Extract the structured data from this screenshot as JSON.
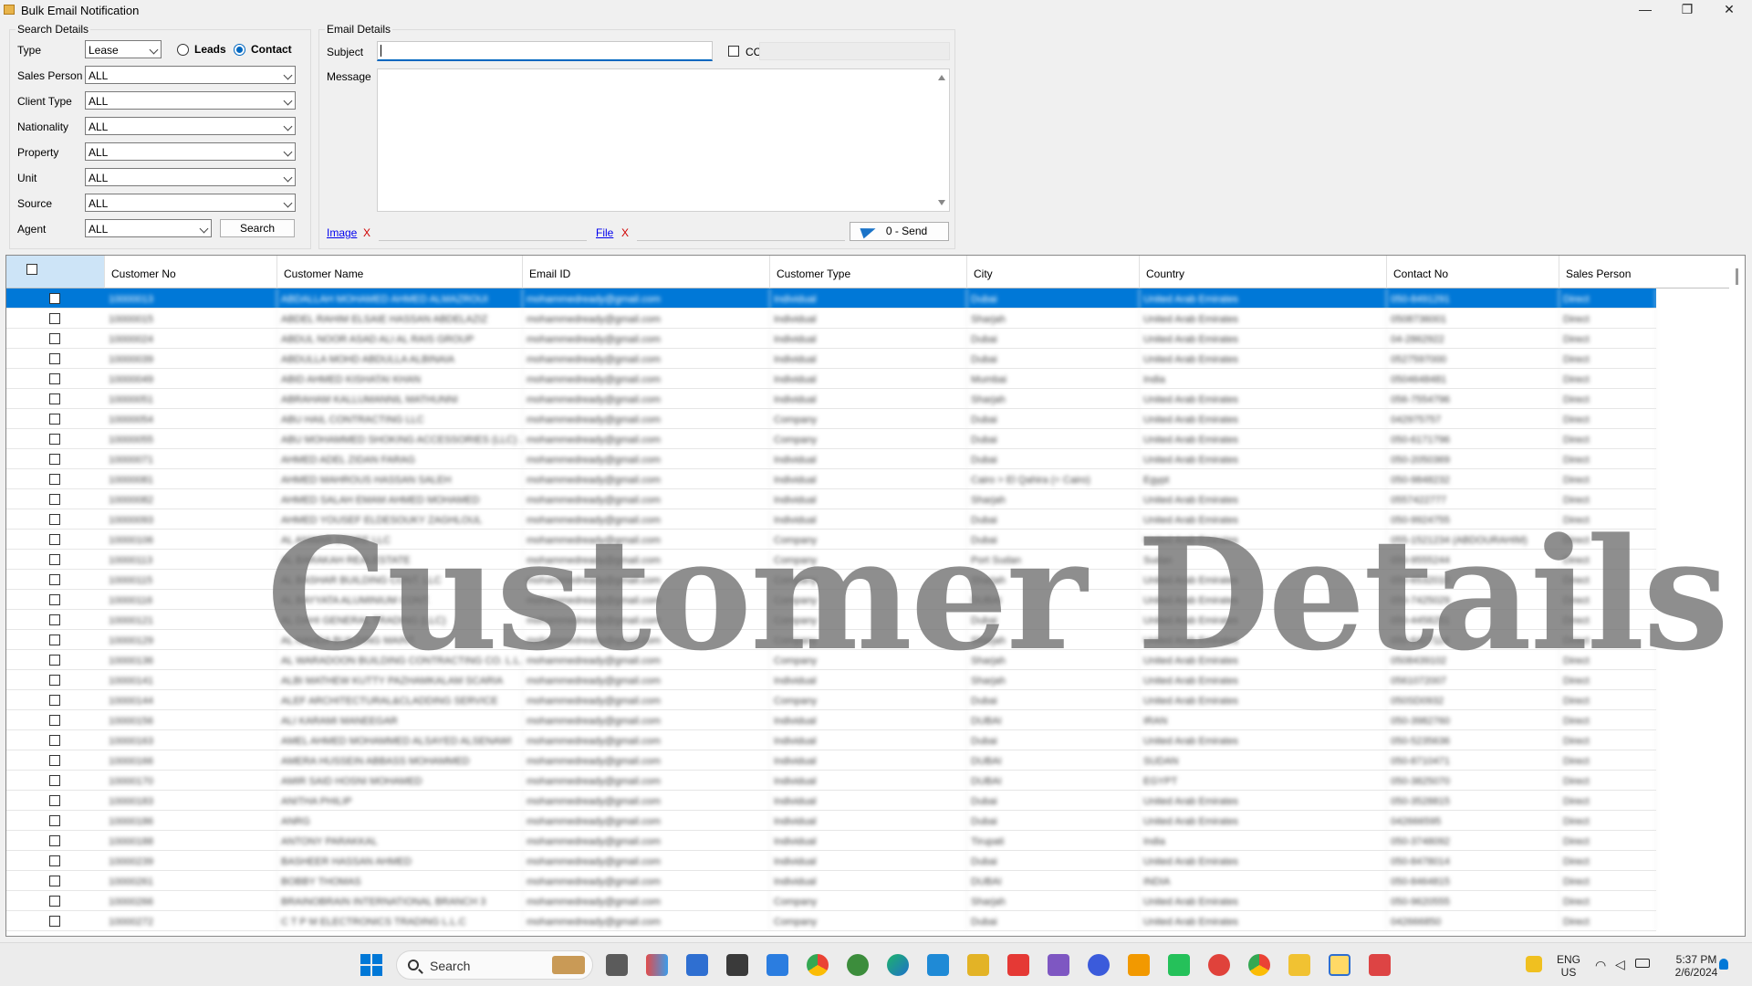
{
  "window": {
    "title": "Bulk Email Notification",
    "controls": {
      "minimize": "—",
      "restore": "❐",
      "close": "✕"
    }
  },
  "search_details": {
    "legend": "Search Details",
    "type_label": "Type",
    "type_value": "Lease",
    "radio_leads": "Leads",
    "radio_contact": "Contact",
    "selected_radio": "Contact",
    "fields": [
      {
        "label": "Sales Person",
        "value": "ALL"
      },
      {
        "label": "Client Type",
        "value": "ALL"
      },
      {
        "label": "Nationality",
        "value": "ALL"
      },
      {
        "label": "Property",
        "value": "ALL"
      },
      {
        "label": "Unit",
        "value": "ALL"
      },
      {
        "label": "Source",
        "value": "ALL"
      }
    ],
    "agent_label": "Agent",
    "agent_value": "ALL",
    "search_button": "Search"
  },
  "email_details": {
    "legend": "Email Details",
    "subject_label": "Subject",
    "subject_value": "",
    "cc_label": "CC",
    "message_label": "Message",
    "image_link": "Image",
    "file_link": "File",
    "remove_glyph": "X",
    "send_button": "0 - Send"
  },
  "grid": {
    "columns": [
      "Customer No",
      "Customer Name",
      "Email ID",
      "Customer Type",
      "City",
      "Country",
      "Contact No",
      "Sales Person"
    ],
    "selected_row": 0,
    "rows": [
      [
        "10000013",
        "ABDALLAH MOHAMED AHMED ALMAZROUI",
        "mohammedready@gmail.com",
        "Individual",
        "Dubai",
        "United Arab Emirates",
        "050-8491291",
        "Direct"
      ],
      [
        "10000015",
        "ABDEL RAHIM ELSAIE HASSAN ABDELAZIZ",
        "mohammedready@gmail.com",
        "Individual",
        "Sharjah",
        "United Arab Emirates",
        "0508736001",
        "Direct"
      ],
      [
        "10000024",
        "ABDUL NOOR ASAD ALI AL RAIS GROUP",
        "mohammedready@gmail.com",
        "Individual",
        "Dubai",
        "United Arab Emirates",
        "04-2862922",
        "Direct"
      ],
      [
        "10000039",
        "ABDULLA MOHD ABDULLA ALBINAIA",
        "mohammedready@gmail.com",
        "Individual",
        "Dubai",
        "United Arab Emirates",
        "0527597000",
        "Direct"
      ],
      [
        "10000049",
        "ABID AHMED KISHATAI KHAN",
        "mohammedready@gmail.com",
        "Individual",
        "Mumbai",
        "India",
        "0504648481",
        "Direct"
      ],
      [
        "10000051",
        "ABRAHAM KALLUMANNIL MATHUNNI",
        "mohammedready@gmail.com",
        "Individual",
        "Sharjah",
        "United Arab Emirates",
        "056-7554796",
        "Direct"
      ],
      [
        "10000054",
        "ABU HAIL CONTRACTING LLC",
        "mohammedready@gmail.com",
        "Company",
        "Dubai",
        "United Arab Emirates",
        "042975757",
        "Direct"
      ],
      [
        "10000055",
        "ABU MOHAMMED SHOKING ACCESSORIES (LLC) ...",
        "mohammedready@gmail.com",
        "Company",
        "Dubai",
        "United Arab Emirates",
        "050-6171796",
        "Direct"
      ],
      [
        "10000071",
        "AHMED ADEL ZIDAN FARAG",
        "mohammedready@gmail.com",
        "Individual",
        "Dubai",
        "United Arab Emirates",
        "050-2050369",
        "Direct"
      ],
      [
        "10000081",
        "AHMED MAHROUS HASSAN SALEH",
        "mohammedready@gmail.com",
        "Individual",
        "Cairo > El Qahira (= Cairo)",
        "Egypt",
        "050-9848232",
        "Direct"
      ],
      [
        "10000082",
        "AHMED SALAH EMAM AHMED MOHAMED",
        "mohammedready@gmail.com",
        "Individual",
        "Sharjah",
        "United Arab Emirates",
        "0557422777",
        "Direct"
      ],
      [
        "10000093",
        "AHMED YOUSEF ELDESOUKY ZAGHLOUL",
        "mohammedready@gmail.com",
        "Individual",
        "Dubai",
        "United Arab Emirates",
        "050-9924755",
        "Direct"
      ],
      [
        "10000106",
        "AL ANWAR STORE LLC",
        "mohammedready@gmail.com",
        "Company",
        "Dubai",
        "United Arab Emirates",
        "055-1521234 (ABDOURAHIM)",
        "Direct"
      ],
      [
        "10000113",
        "AL BARAKAH REALESTATE",
        "mohammedready@gmail.com",
        "Company",
        "Port Sudan",
        "Sudan",
        "050-9555244",
        "Direct"
      ],
      [
        "10000115",
        "AL BASHAR BUILDING CONT. LLC",
        "mohammedready@gmail.com",
        "Company",
        "Sharjah",
        "United Arab Emirates",
        "050-6532010",
        "Direct"
      ],
      [
        "10000116",
        "AL BAYYATA ALUMINIUM CONT.",
        "mohammedready@gmail.com",
        "Company",
        "DUBAI",
        "United Arab Emirates",
        "050-7425029",
        "Direct"
      ],
      [
        "10000121",
        "AL DAHI GENERAL TRADING (LLC)",
        "mohammedready@gmail.com",
        "Company",
        "Dubai",
        "United Arab Emirates",
        "050-4458251",
        "Direct"
      ],
      [
        "10000129",
        "AL NAHDA BUILDING MAINT.",
        "mohammedready@gmail.com",
        "Company",
        "Sharjah",
        "United Arab Emirates",
        "050-6427114",
        "Direct"
      ],
      [
        "10000136",
        "AL WARADOON BUILDING CONTRACTING CO. L.L.C.",
        "mohammedready@gmail.com",
        "Company",
        "Sharjah",
        "United Arab Emirates",
        "0508439102",
        "Direct"
      ],
      [
        "10000141",
        "ALBI MATHEW KUTTY PAZHAMKALAM SCARIA",
        "mohammedready@gmail.com",
        "Individual",
        "Sharjah",
        "United Arab Emirates",
        "0561072007",
        "Direct"
      ],
      [
        "10000144",
        "ALEF ARCHITECTURAL&CLADDING SERVICE",
        "mohammedready@gmail.com",
        "Company",
        "Dubai",
        "United Arab Emirates",
        "050SD0932",
        "Direct"
      ],
      [
        "10000156",
        "ALI KARAMI MANEEGAR",
        "mohammedready@gmail.com",
        "Individual",
        "DUBAI",
        "IRAN",
        "050-3982760",
        "Direct"
      ],
      [
        "10000163",
        "AMEL AHMED MOHAMMED ALSAYED ALSENAWI",
        "mohammedready@gmail.com",
        "Individual",
        "Dubai",
        "United Arab Emirates",
        "050-5235636",
        "Direct"
      ],
      [
        "10000166",
        "AMERA HUSSEIN ABBASS MOHAMMED",
        "mohammedready@gmail.com",
        "Individual",
        "DUBAI",
        "SUDAN",
        "050-8710471",
        "Direct"
      ],
      [
        "10000170",
        "AMIR SAID HOSNI MOHAMED",
        "mohammedready@gmail.com",
        "Individual",
        "DUBAI",
        "EGYPT",
        "050-3825070",
        "Direct"
      ],
      [
        "10000183",
        "ANITHA PHILIP",
        "mohammedready@gmail.com",
        "Individual",
        "Dubai",
        "United Arab Emirates",
        "050-3528815",
        "Direct"
      ],
      [
        "10000186",
        "ANRG",
        "mohammedready@gmail.com",
        "Individual",
        "Dubai",
        "United Arab Emirates",
        "042666595",
        "Direct"
      ],
      [
        "10000188",
        "ANTONY PARAKKAL",
        "mohammedready@gmail.com",
        "Individual",
        "Tirupati",
        "India",
        "050-3748092",
        "Direct"
      ],
      [
        "10000239",
        "BASHEER HASSAN AHMED",
        "mohammedready@gmail.com",
        "Individual",
        "Dubai",
        "United Arab Emirates",
        "050-8478014",
        "Direct"
      ],
      [
        "10000261",
        "BOBBY THOMAS",
        "mohammedready@gmail.com",
        "Individual",
        "DUBAI",
        "INDIA",
        "050-8464815",
        "Direct"
      ],
      [
        "10000266",
        "BRAINOBRAIN INTERNATIONAL BRANCH 3",
        "mohammedready@gmail.com",
        "Company",
        "Sharjah",
        "United Arab Emirates",
        "050-9620555",
        "Direct"
      ],
      [
        "10000272",
        "C T P M ELECTRONICS TRADING L.L.C",
        "mohammedready@gmail.com",
        "Company",
        "Dubai",
        "United Arab Emirates",
        "042666850",
        "Direct"
      ]
    ]
  },
  "watermark": "Customer Details",
  "taskbar": {
    "search_text": "Search",
    "language_top": "ENG",
    "language_bottom": "US",
    "time": "5:37 PM",
    "date": "2/6/2024",
    "icons": [
      "start-icon",
      "widgets-icon",
      "task-view-icon",
      "copilot-icon",
      "files-icon",
      "calculator-icon",
      "notepad-icon",
      "chrome-icon",
      "edge-dev-icon",
      "edge-icon",
      "vscode-icon",
      "sql-icon",
      "anydesk-icon",
      "visual-studio-icon",
      "firefox-icon",
      "sublime-icon",
      "whatsapp-icon",
      "ssms-icon",
      "chrome-icon-2",
      "file-explorer-icon",
      "bulk-email-app-icon",
      "crystal-reports-icon"
    ],
    "colors": {
      "accent": "#0078d7",
      "selected_row": "#0078d7",
      "link": "#0000ee",
      "remove": "#d00000"
    }
  }
}
